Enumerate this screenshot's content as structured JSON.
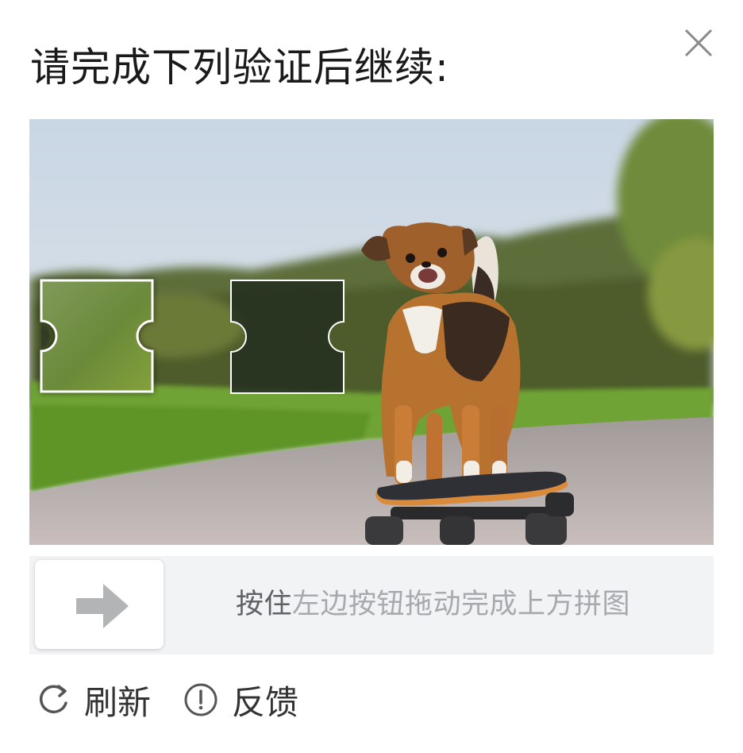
{
  "dialog": {
    "title": "请完成下列验证后继续:",
    "close_icon": "close-icon"
  },
  "captcha": {
    "image_subject": "chihuahua-on-skateboard",
    "slider_piece_icon": "puzzle-piece",
    "target_slot_icon": "puzzle-slot"
  },
  "slider": {
    "handle_icon": "arrow-right-icon",
    "hint_emphasis": "按住",
    "hint_rest": "左边按钮拖动完成上方拼图"
  },
  "footer": {
    "refresh_icon": "refresh-icon",
    "refresh_label": "刷新",
    "feedback_icon": "exclamation-circle-icon",
    "feedback_label": "反馈"
  },
  "colors": {
    "slider_track": "#f2f3f5",
    "hint_text": "#a7a9ad",
    "arrow": "#b3b4b6"
  }
}
